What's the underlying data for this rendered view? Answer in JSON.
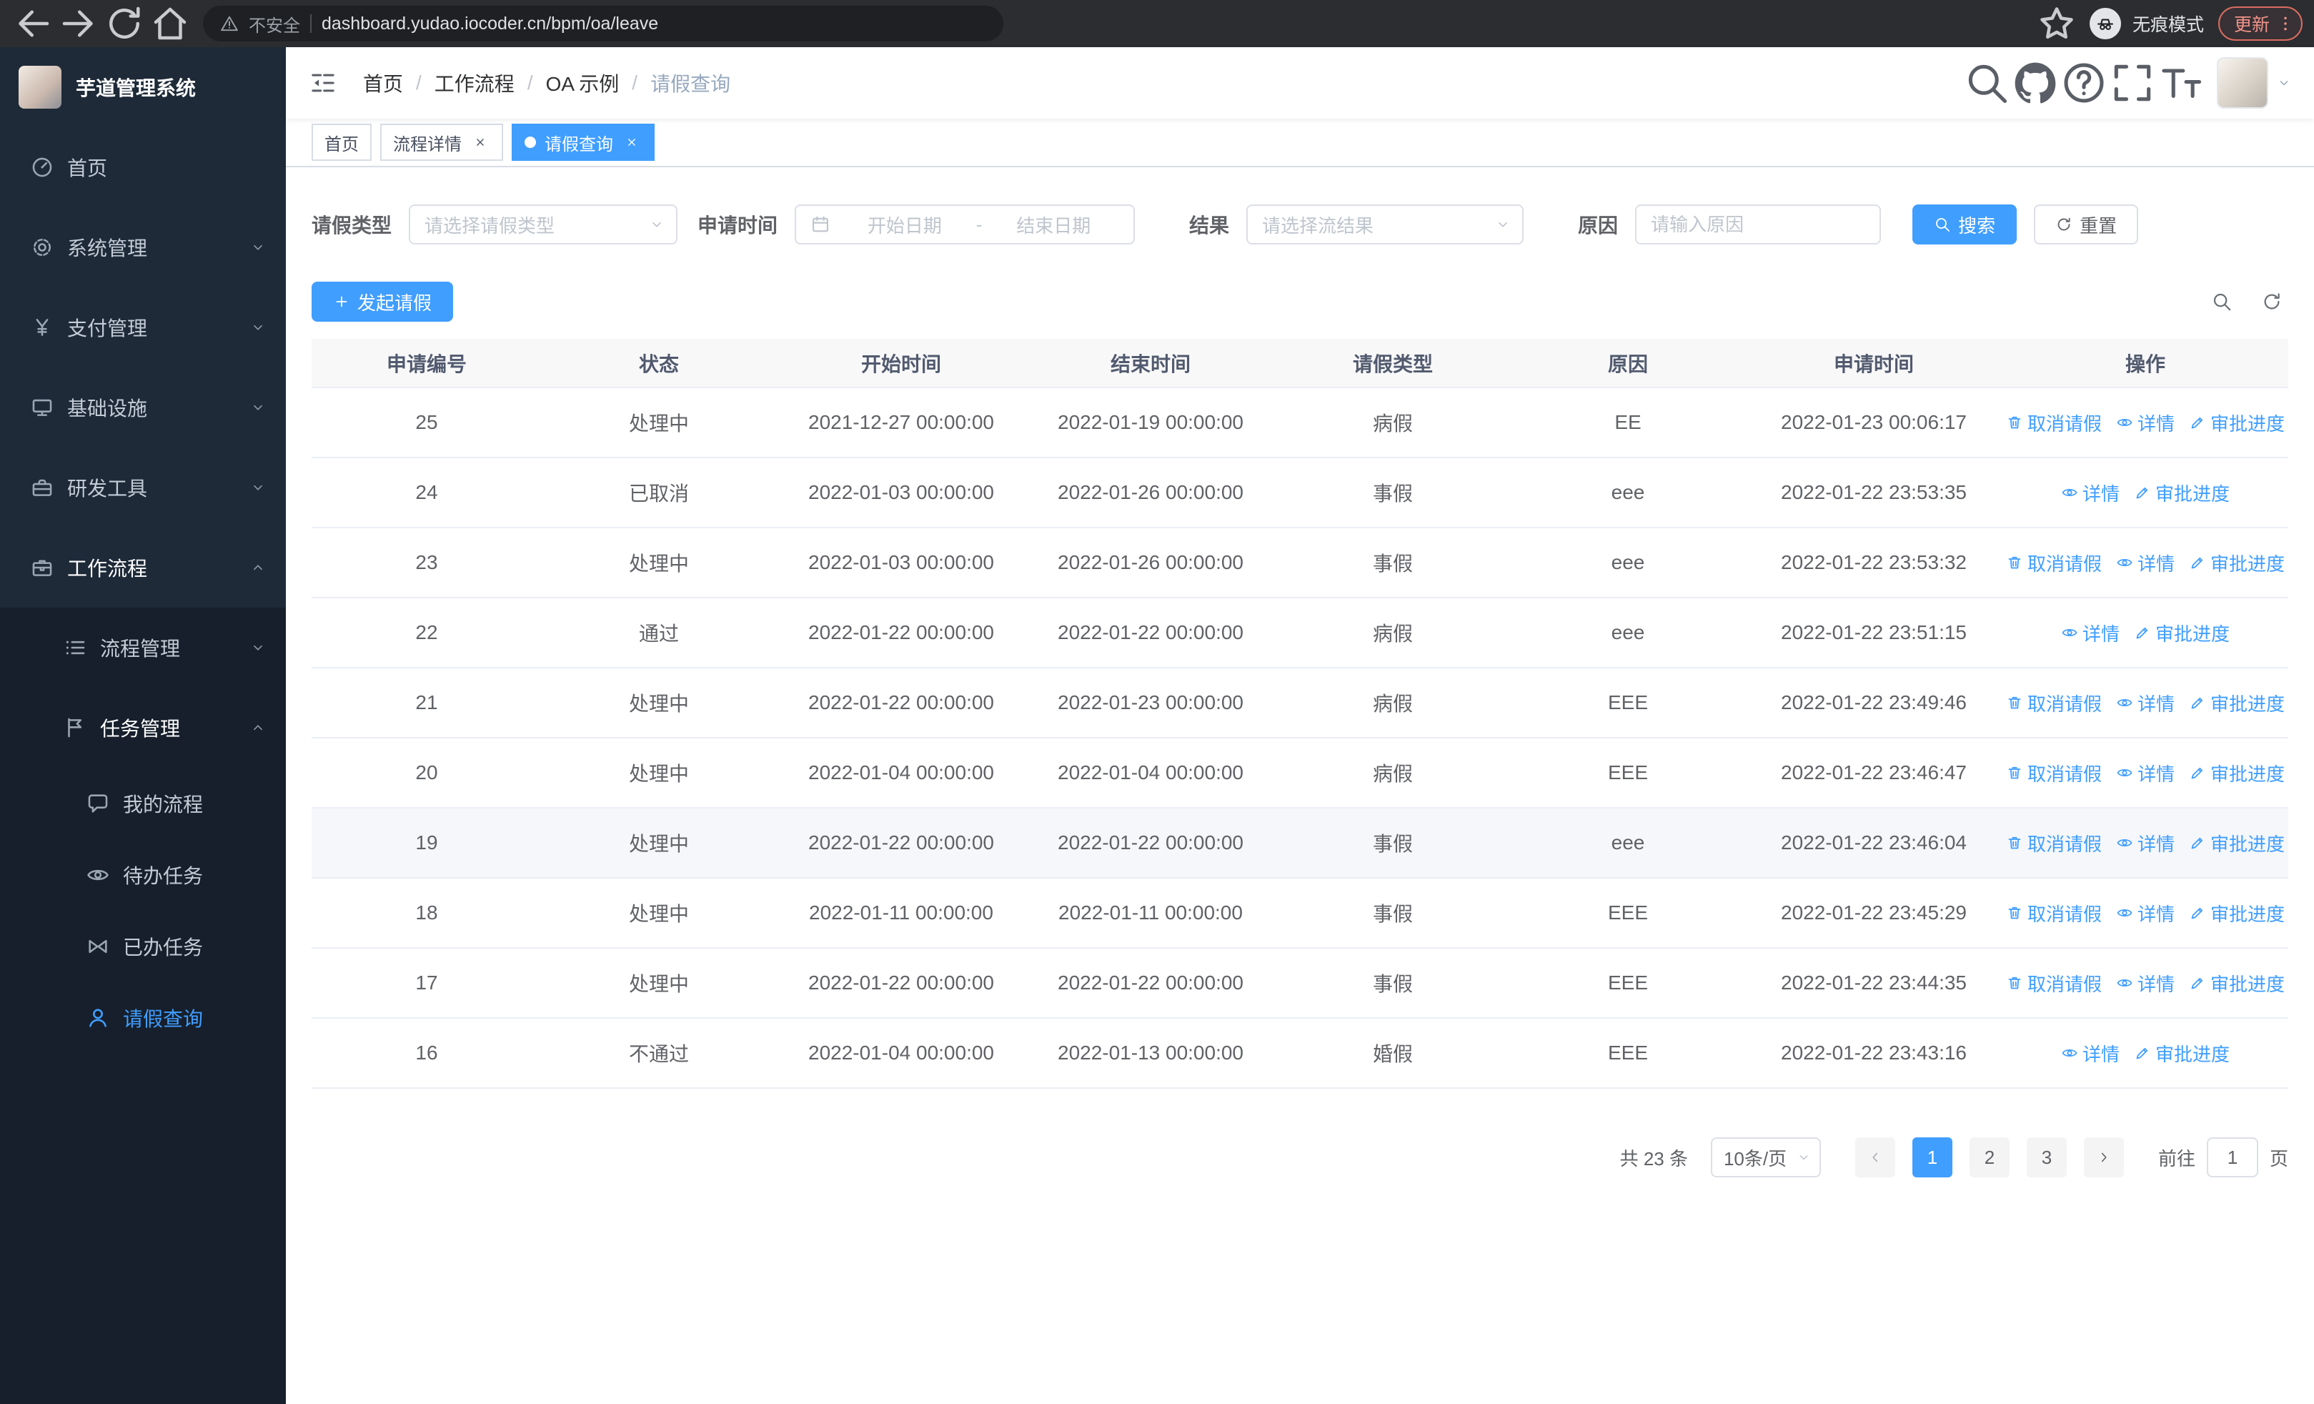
{
  "browser": {
    "security_label": "不安全",
    "url": "dashboard.yudao.iocoder.cn/bpm/oa/leave",
    "incognito_label": "无痕模式",
    "update_label": "更新"
  },
  "sidebar": {
    "logo_title": "芋道管理系统",
    "items": [
      {
        "key": "home",
        "label": "首页",
        "icon": "dashboard",
        "level": 1
      },
      {
        "key": "system",
        "label": "系统管理",
        "icon": "gear",
        "level": 1,
        "chevron": "down"
      },
      {
        "key": "payment",
        "label": "支付管理",
        "icon": "yen",
        "level": 1,
        "chevron": "down"
      },
      {
        "key": "infrastructure",
        "label": "基础设施",
        "icon": "monitor",
        "level": 1,
        "chevron": "down"
      },
      {
        "key": "devtools",
        "label": "研发工具",
        "icon": "toolbox",
        "level": 1,
        "chevron": "down"
      },
      {
        "key": "workflow",
        "label": "工作流程",
        "icon": "briefcase",
        "level": 1,
        "chevron": "up",
        "expanded": true
      },
      {
        "key": "process-management",
        "label": "流程管理",
        "icon": "list",
        "level": 2,
        "chevron": "down"
      },
      {
        "key": "task-management",
        "label": "任务管理",
        "icon": "flag",
        "level": 2,
        "chevron": "up",
        "expanded": true
      },
      {
        "key": "my-process",
        "label": "我的流程",
        "icon": "chat",
        "level": 3
      },
      {
        "key": "todo-task",
        "label": "待办任务",
        "icon": "eye",
        "level": 3
      },
      {
        "key": "done-task",
        "label": "已办任务",
        "icon": "bowtie",
        "level": 3
      },
      {
        "key": "leave-query",
        "label": "请假查询",
        "icon": "user",
        "level": 3,
        "active": true
      }
    ]
  },
  "header": {
    "breadcrumb": [
      "首页",
      "工作流程",
      "OA 示例",
      "请假查询"
    ]
  },
  "tabs": [
    {
      "key": "home",
      "label": "首页"
    },
    {
      "key": "process-detail",
      "label": "流程详情",
      "closable": true
    },
    {
      "key": "leave-query",
      "label": "请假查询",
      "closable": true,
      "active": true
    }
  ],
  "filters": {
    "leave_type_label": "请假类型",
    "leave_type_placeholder": "请选择请假类型",
    "apply_time_label": "申请时间",
    "start_date_placeholder": "开始日期",
    "range_separator": "-",
    "end_date_placeholder": "结束日期",
    "result_label": "结果",
    "result_placeholder": "请选择流结果",
    "reason_label": "原因",
    "reason_placeholder": "请输入原因",
    "search_label": "搜索",
    "reset_label": "重置"
  },
  "toolbar": {
    "create_label": "发起请假"
  },
  "table": {
    "columns": [
      "申请编号",
      "状态",
      "开始时间",
      "结束时间",
      "请假类型",
      "原因",
      "申请时间",
      "操作"
    ],
    "actions": {
      "cancel": "取消请假",
      "detail": "详情",
      "progress": "审批进度"
    },
    "rows": [
      {
        "id": "25",
        "status": "处理中",
        "start_time": "2021-12-27 00:00:00",
        "end_time": "2022-01-19 00:00:00",
        "leave_type": "病假",
        "reason": "EE",
        "apply_time": "2022-01-23 00:06:17",
        "cancellable": true
      },
      {
        "id": "24",
        "status": "已取消",
        "start_time": "2022-01-03 00:00:00",
        "end_time": "2022-01-26 00:00:00",
        "leave_type": "事假",
        "reason": "eee",
        "apply_time": "2022-01-22 23:53:35",
        "cancellable": false
      },
      {
        "id": "23",
        "status": "处理中",
        "start_time": "2022-01-03 00:00:00",
        "end_time": "2022-01-26 00:00:00",
        "leave_type": "事假",
        "reason": "eee",
        "apply_time": "2022-01-22 23:53:32",
        "cancellable": true
      },
      {
        "id": "22",
        "status": "通过",
        "start_time": "2022-01-22 00:00:00",
        "end_time": "2022-01-22 00:00:00",
        "leave_type": "病假",
        "reason": "eee",
        "apply_time": "2022-01-22 23:51:15",
        "cancellable": false
      },
      {
        "id": "21",
        "status": "处理中",
        "start_time": "2022-01-22 00:00:00",
        "end_time": "2022-01-23 00:00:00",
        "leave_type": "病假",
        "reason": "EEE",
        "apply_time": "2022-01-22 23:49:46",
        "cancellable": true
      },
      {
        "id": "20",
        "status": "处理中",
        "start_time": "2022-01-04 00:00:00",
        "end_time": "2022-01-04 00:00:00",
        "leave_type": "病假",
        "reason": "EEE",
        "apply_time": "2022-01-22 23:46:47",
        "cancellable": true
      },
      {
        "id": "19",
        "status": "处理中",
        "start_time": "2022-01-22 00:00:00",
        "end_time": "2022-01-22 00:00:00",
        "leave_type": "事假",
        "reason": "eee",
        "apply_time": "2022-01-22 23:46:04",
        "cancellable": true,
        "highlight": true
      },
      {
        "id": "18",
        "status": "处理中",
        "start_time": "2022-01-11 00:00:00",
        "end_time": "2022-01-11 00:00:00",
        "leave_type": "事假",
        "reason": "EEE",
        "apply_time": "2022-01-22 23:45:29",
        "cancellable": true
      },
      {
        "id": "17",
        "status": "处理中",
        "start_time": "2022-01-22 00:00:00",
        "end_time": "2022-01-22 00:00:00",
        "leave_type": "事假",
        "reason": "EEE",
        "apply_time": "2022-01-22 23:44:35",
        "cancellable": true
      },
      {
        "id": "16",
        "status": "不通过",
        "start_time": "2022-01-04 00:00:00",
        "end_time": "2022-01-13 00:00:00",
        "leave_type": "婚假",
        "reason": "EEE",
        "apply_time": "2022-01-22 23:43:16",
        "cancellable": false
      }
    ]
  },
  "pagination": {
    "total_label": "共 23 条",
    "page_size_label": "10条/页",
    "pages": [
      "1",
      "2",
      "3"
    ],
    "active_page": "1",
    "goto_label": "前往",
    "goto_value": "1",
    "goto_suffix": "页"
  },
  "colors": {
    "primary": "#409eff",
    "sidebar_bg": "#1e2a38",
    "active_tab_bg": "#409eff"
  }
}
